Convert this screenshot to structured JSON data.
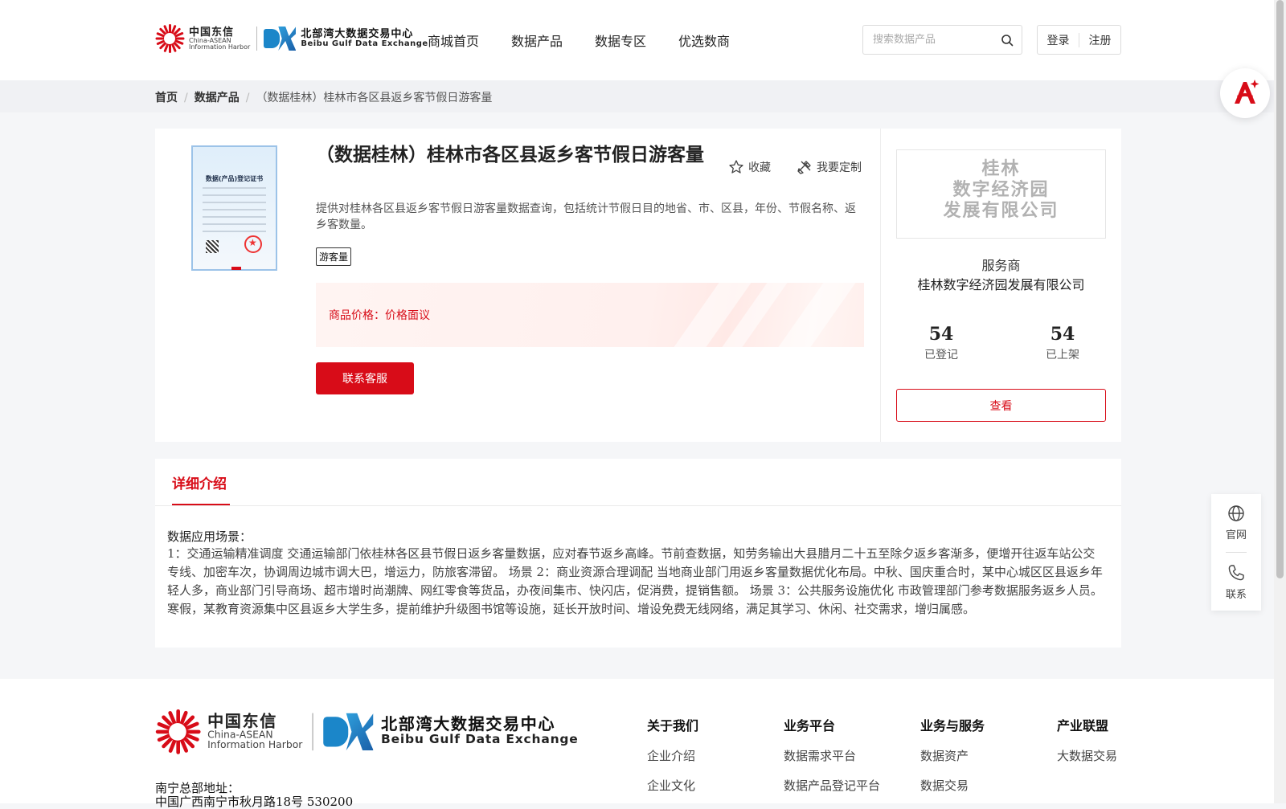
{
  "header": {
    "logo_cn": "中国东信",
    "logo_cn_en1": "China-ASEAN",
    "logo_cn_en2": "Information Harbor",
    "logo_bx_cn": "北部湾大数据交易中心",
    "logo_bx_en": "Beibu Gulf Data Exchange",
    "nav": [
      "商城首页",
      "数据产品",
      "数据专区",
      "优选数商"
    ],
    "search_placeholder": "搜索数据产品",
    "login": "登录",
    "register": "注册"
  },
  "breadcrumb": {
    "home": "首页",
    "products": "数据产品",
    "current": "（数据桂林）桂林市各区县返乡客节假日游客量"
  },
  "product": {
    "title": "（数据桂林）桂林市各区县返乡客节假日游客量",
    "favorite": "收藏",
    "customize": "我要定制",
    "description": "提供对桂林各区县返乡客节假日游客量数据查询，包括统计节假日目的地省、市、区县，年份、节假名称、返乡客数量。",
    "tag": "游客量",
    "price_label": "商品价格：",
    "price_value": "价格面议",
    "contact_button": "联系客服",
    "certificate_title": "数据(产品)登记证书"
  },
  "vendor": {
    "logo_lines": [
      "桂林",
      "数字经济园",
      "发展有限公司"
    ],
    "role": "服务商",
    "name": "桂林数字经济园发展有限公司",
    "registered_count": "54",
    "registered_label": "已登记",
    "listed_count": "54",
    "listed_label": "已上架",
    "view_button": "查看"
  },
  "detail": {
    "tab": "详细介绍",
    "heading": "数据应用场景：",
    "body": "1：交通运输精准调度 交通运输部门依桂林各区县节假日返乡客量数据，应对春节返乡高峰。节前查数据，知劳务输出大县腊月二十五至除夕返乡客渐多，便增开往返车站公交专线、加密车次，协调周边城市调大巴，增运力，防旅客滞留。 场景 2：商业资源合理调配 当地商业部门用返乡客量数据优化布局。中秋、国庆重合时，某中心城区区县返乡年轻人多，商业部门引导商场、超市增时尚潮牌、网红零食等货品，办夜间集市、快闪店，促消费，提销售额。 场景 3：公共服务设施优化 市政管理部门参考数据服务返乡人员。寒假，某教育资源集中区县返乡大学生多，提前维护升级图书馆等设施，延长开放时间、增设免费无线网络，满足其学习、休闲、社交需求，增归属感。"
  },
  "float": {
    "website": "官网",
    "contact": "联系"
  },
  "footer": {
    "columns": [
      {
        "title": "关于我们",
        "items": [
          "企业介绍",
          "企业文化"
        ]
      },
      {
        "title": "业务平台",
        "items": [
          "数据需求平台",
          "数据产品登记平台"
        ]
      },
      {
        "title": "业务与服务",
        "items": [
          "数据资产",
          "数据交易"
        ]
      },
      {
        "title": "产业联盟",
        "items": [
          "大数据交易"
        ]
      }
    ],
    "address_title": "南宁总部地址：",
    "address_line": "中国广西南宁市秋月路18号 530200"
  },
  "colors": {
    "accent": "#d80c18",
    "logo_blue": "#1b86c9"
  }
}
